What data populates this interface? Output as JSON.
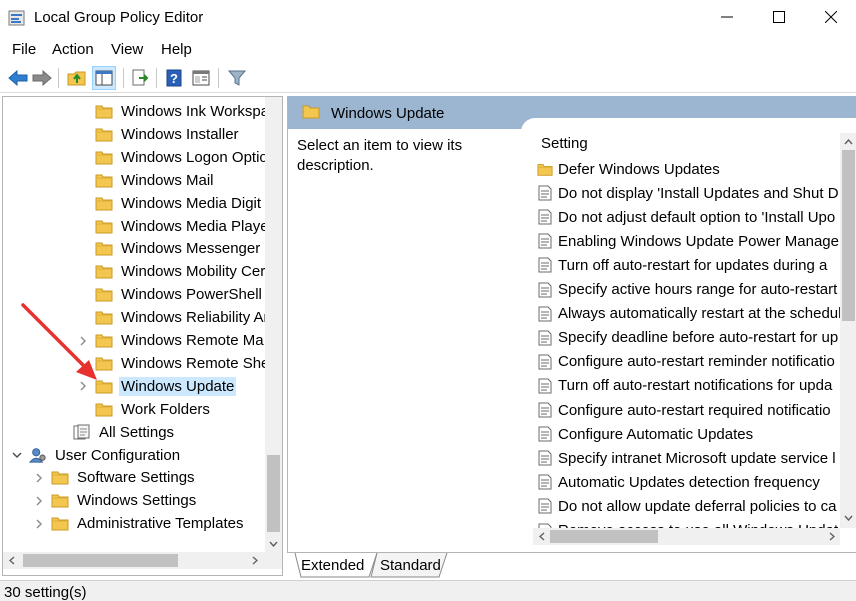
{
  "window": {
    "title": "Local Group Policy Editor",
    "minimize_icon": "minimize-icon",
    "maximize_icon": "maximize-icon",
    "close_icon": "close-icon"
  },
  "menu": [
    "File",
    "Action",
    "View",
    "Help"
  ],
  "toolbar": {
    "icons": [
      "back-arrow-icon",
      "forward-arrow-icon",
      "up-folder-icon",
      "show-hide-tree-icon",
      "export-list-icon",
      "help-icon",
      "properties-view-icon",
      "filter-icon"
    ]
  },
  "tree": {
    "items": [
      {
        "label": "Windows Ink Workspa",
        "level": 3,
        "expander": false,
        "icon": "folder-icon"
      },
      {
        "label": "Windows Installer",
        "level": 3,
        "expander": false,
        "icon": "folder-icon"
      },
      {
        "label": "Windows Logon Optio",
        "level": 3,
        "expander": false,
        "icon": "folder-icon"
      },
      {
        "label": "Windows Mail",
        "level": 3,
        "expander": false,
        "icon": "folder-icon"
      },
      {
        "label": "Windows Media Digit",
        "level": 3,
        "expander": false,
        "icon": "folder-icon"
      },
      {
        "label": "Windows Media Playe",
        "level": 3,
        "expander": false,
        "icon": "folder-icon"
      },
      {
        "label": "Windows Messenger",
        "level": 3,
        "expander": false,
        "icon": "folder-icon"
      },
      {
        "label": "Windows Mobility Cer",
        "level": 3,
        "expander": false,
        "icon": "folder-icon"
      },
      {
        "label": "Windows PowerShell",
        "level": 3,
        "expander": false,
        "icon": "folder-icon"
      },
      {
        "label": "Windows Reliability Ar",
        "level": 3,
        "expander": false,
        "icon": "folder-icon"
      },
      {
        "label": "Windows Remote Ma",
        "level": 3,
        "expander": true,
        "icon": "folder-icon"
      },
      {
        "label": "Windows Remote She",
        "level": 3,
        "expander": false,
        "icon": "folder-icon"
      },
      {
        "label": "Windows Update",
        "level": 3,
        "expander": true,
        "icon": "folder-icon",
        "selected": true
      },
      {
        "label": "Work Folders",
        "level": 3,
        "expander": false,
        "icon": "folder-icon"
      },
      {
        "label": "All Settings",
        "level": 2,
        "expander": false,
        "icon": "all-settings-icon"
      },
      {
        "label": "User Configuration",
        "level": 0,
        "expander": "open",
        "icon": "user-config-icon"
      },
      {
        "label": "Software Settings",
        "level": 1,
        "expander": true,
        "icon": "folder-icon"
      },
      {
        "label": "Windows Settings",
        "level": 1,
        "expander": true,
        "icon": "folder-icon"
      },
      {
        "label": "Administrative Templates",
        "level": 1,
        "expander": true,
        "icon": "folder-icon"
      }
    ]
  },
  "right": {
    "header_title": "Windows Update",
    "description": "Select an item to view its description.",
    "column_header": "Setting",
    "settings": [
      {
        "label": "Defer Windows Updates",
        "icon": "folder-icon"
      },
      {
        "label": "Do not display 'Install Updates and Shut D",
        "icon": "policy-icon"
      },
      {
        "label": "Do not adjust default option to 'Install Upo",
        "icon": "policy-icon"
      },
      {
        "label": "Enabling Windows Update Power Manage",
        "icon": "policy-icon"
      },
      {
        "label": "Turn off auto-restart for updates during a",
        "icon": "policy-icon"
      },
      {
        "label": "Specify active hours range for auto-restart",
        "icon": "policy-icon"
      },
      {
        "label": "Always automatically restart at the schedul",
        "icon": "policy-icon"
      },
      {
        "label": "Specify deadline before auto-restart for up",
        "icon": "policy-icon"
      },
      {
        "label": "Configure auto-restart reminder notificatio",
        "icon": "policy-icon"
      },
      {
        "label": "Turn off auto-restart notifications for upda",
        "icon": "policy-icon"
      },
      {
        "label": "Configure auto-restart required notificatio",
        "icon": "policy-icon"
      },
      {
        "label": "Configure Automatic Updates",
        "icon": "policy-icon"
      },
      {
        "label": "Specify intranet Microsoft update service l",
        "icon": "policy-icon"
      },
      {
        "label": "Automatic Updates detection frequency",
        "icon": "policy-icon"
      },
      {
        "label": "Do not allow update deferral policies to ca",
        "icon": "policy-icon"
      },
      {
        "label": "Remove access to use all Windows Updat",
        "icon": "policy-icon"
      }
    ]
  },
  "tabs": [
    "Extended",
    "Standard"
  ],
  "status": "30 setting(s)",
  "colors": {
    "header_bg": "#9cb6d2",
    "selection": "#cce8ff",
    "annotation_arrow": "#e8312f",
    "folder": "#f3c64f"
  }
}
